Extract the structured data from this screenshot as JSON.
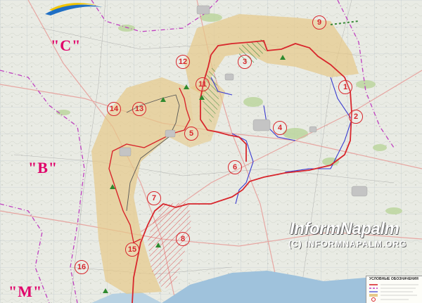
{
  "map": {
    "zones": [
      {
        "label": "9"
      },
      {
        "label": "3"
      },
      {
        "label": "12"
      },
      {
        "label": "11"
      },
      {
        "label": "1"
      },
      {
        "label": "14"
      },
      {
        "label": "13"
      },
      {
        "label": "2"
      },
      {
        "label": "4"
      },
      {
        "label": "5"
      },
      {
        "label": "6"
      },
      {
        "label": "7"
      },
      {
        "label": "8"
      },
      {
        "label": "15"
      },
      {
        "label": "16"
      }
    ],
    "sectors": [
      {
        "label": "\"C\""
      },
      {
        "label": "\"B\""
      },
      {
        "label": "\"M\""
      }
    ],
    "colors": {
      "front_line": "#d8262c",
      "zone_fill": "#e6c98a",
      "sector_border": "#c040c0",
      "region_border": "#3a3ad0",
      "water": "#9fc2dc",
      "base": "#e9ebe4"
    }
  },
  "logo": {
    "title": "InformNapalm",
    "copyright": "(C) INFORMNAPALM.ORG"
  },
  "legend": {
    "title": "УСЛОВНЫЕ ОБОЗНАЧЕНИЯ"
  }
}
